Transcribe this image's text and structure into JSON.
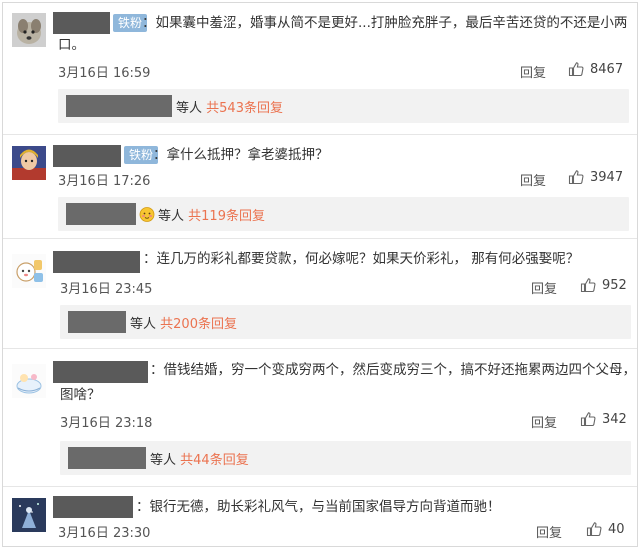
{
  "comments": [
    {
      "badge": "铁粉",
      "text_line1": "：如果囊中羞涩，婚事从简不是更好...打肿脸充胖子，最后辛苦还贷的不还是小两",
      "text_line2": "口。",
      "time": "3月16日 16:59",
      "reply": "回复",
      "likes": "8467",
      "sub": {
        "prefix": "等人",
        "count": "共543条回复"
      }
    },
    {
      "badge": "铁粉",
      "text_line1": "：拿什么抵押？拿老婆抵押？",
      "time": "3月16日 17:26",
      "reply": "回复",
      "likes": "3947",
      "sub": {
        "prefix": "等人",
        "count": "共119条回复"
      }
    },
    {
      "text_line1": "：连几万的彩礼都要贷款，何必嫁呢？如果天价彩礼， 那有何必强娶呢？",
      "time": "3月16日 23:45",
      "reply": "回复",
      "likes": "952",
      "sub": {
        "prefix": "等人",
        "count": "共200条回复"
      }
    },
    {
      "text_line1": "：借钱结婚，穷一个变成穷两个，然后变成穷三个，搞不好还拖累两边四个父母，",
      "text_line2": "图啥？",
      "time": "3月16日 23:18",
      "reply": "回复",
      "likes": "342",
      "sub": {
        "prefix": "等人",
        "count": "共44条回复"
      }
    },
    {
      "text_line1": "：银行无德，助长彩礼风气，与当前国家倡导方向背道而驰！",
      "time": "3月16日 23:30",
      "reply": "回复",
      "likes": "40"
    }
  ],
  "icons": {
    "like": "thumbs-up-icon",
    "emoji": "blush-emoji-icon"
  },
  "colors": {
    "count": "#eb7350",
    "badge": "#8fb7db",
    "redaction": "#5a5a5a",
    "subbox": "#f2f2f2"
  }
}
